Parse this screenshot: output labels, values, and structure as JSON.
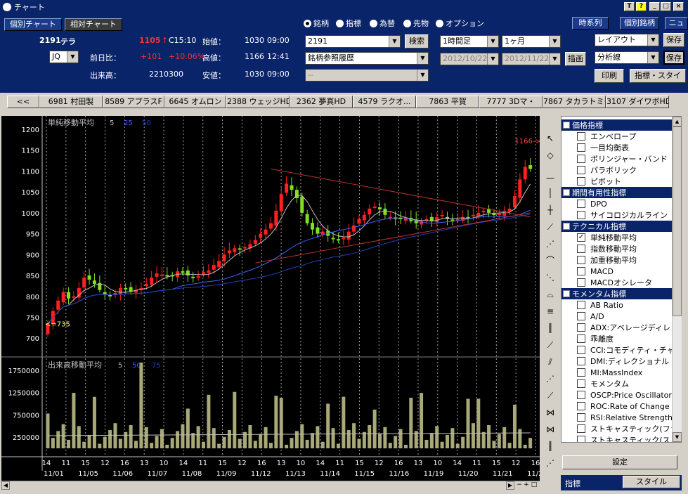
{
  "window": {
    "title": "チャート",
    "buttons": [
      "T",
      "?",
      "_",
      "□",
      "×"
    ]
  },
  "top": {
    "tab_individual": "個別チャート",
    "tab_relative": "相対チャート",
    "code": "2191",
    "name": "テラ",
    "price": "1105",
    "arrow": "↑",
    "time": "C15:10",
    "open_label": "始値：",
    "open_value": "1030",
    "open_time": "09:00",
    "high_label": "高値：",
    "high_value": "1166",
    "high_time": "12:41",
    "low_label": "安値：",
    "low_value": "1030",
    "low_time": "09:00",
    "market": "JQ",
    "change_label": "前日比：",
    "change_value": "+101",
    "change_pct": "+10.06%",
    "volume_label": "出来高：",
    "volume_value": "2210300",
    "radios": [
      "銘柄",
      "指標",
      "為替",
      "先物",
      "オプション"
    ],
    "radio_selected": 0,
    "symbol_input": "2191",
    "search_btn": "検索",
    "history_combo": "銘柄参照履歴",
    "third_combo": "--",
    "interval": "1時間足",
    "period": "1ヶ月",
    "date_from": "2012/10/22",
    "date_to": "2012/11/22",
    "draw_btn": "描画",
    "timeseries_btn": "時系列",
    "individual_btn": "個別銘柄",
    "news_btn": "ニュ",
    "layout_combo": "レイアウト",
    "save1": "保存",
    "analysis_combo": "分析線",
    "save2": "保存",
    "print_btn": "印刷",
    "indicator_style_btn": "指標・スタイ"
  },
  "stocks": [
    "<<",
    "6981 村田製",
    "8589 アプラスF",
    "6645 オムロン",
    "2388 ウェッジHD",
    "2362 夢真HD",
    "4579 ラクオ...",
    "7863 平賀",
    "7777 3Dマ・",
    "7867 タカラトミー",
    "3107 ダイワボHD"
  ],
  "chart_data": {
    "type": "candlestick",
    "price_title": "単純移動平均",
    "price_ma": [
      "5",
      "25",
      "50"
    ],
    "volume_title": "出来高移動平均",
    "volume_ma": [
      "5",
      "50",
      "75"
    ],
    "yticks": [
      1200,
      1150,
      1100,
      1050,
      1000,
      950,
      900,
      850,
      800,
      750,
      700
    ],
    "ylim": [
      660,
      1215
    ],
    "vol_ticks": [
      1750000,
      1250000,
      750000,
      250000
    ],
    "vol_tick_labels": [
      "1750000",
      "1250000",
      "750000",
      "250000"
    ],
    "vol_max": 2000000,
    "low_mark": "<=735",
    "high_mark": "1166->",
    "xticks": [
      "14",
      "11",
      "15",
      "12",
      "16",
      "13",
      "10",
      "14",
      "11",
      "15",
      "12",
      "16",
      "13",
      "10",
      "14",
      "11",
      "15",
      "12",
      "16",
      "13",
      "10",
      "14",
      "11",
      "15",
      "12",
      "16"
    ],
    "dates": [
      "11/01",
      "11/05",
      "11/06",
      "11/07",
      "11/08",
      "11/09",
      "11/12",
      "11/13",
      "11/14",
      "11/15",
      "11/16",
      "11/19",
      "11/20",
      "11/21",
      "11/22"
    ],
    "close": [
      735,
      765,
      790,
      810,
      795,
      800,
      820,
      845,
      840,
      830,
      815,
      805,
      800,
      808,
      820,
      818,
      812,
      815,
      820,
      830,
      845,
      855,
      852,
      848,
      850,
      860,
      858,
      850,
      845,
      848,
      858,
      862,
      875,
      885,
      900,
      910,
      915,
      912,
      918,
      925,
      935,
      950,
      960,
      975,
      1005,
      1045,
      1070,
      1055,
      1035,
      1000,
      975,
      960,
      950,
      955,
      945,
      938,
      935,
      940,
      955,
      970,
      985,
      995,
      1010,
      1015,
      1008,
      995,
      990,
      985,
      985,
      988,
      980,
      975,
      980,
      985,
      980,
      990,
      995,
      985,
      982,
      985,
      990,
      988,
      995,
      1000,
      1005,
      1000,
      995,
      998,
      1005,
      1010,
      1040,
      1080,
      1110,
      1105
    ],
    "colors": {
      "up": "#ff2020",
      "down": "#80e020",
      "ma5": "#c0c0c0",
      "ma25": "#4060ff",
      "ma50": "#2040c0",
      "trend": "#c03030",
      "volume": "#a8a878",
      "accent": "#0a246a"
    }
  },
  "indicators": {
    "categories": [
      {
        "name": "価格指標",
        "items": [
          "エンベロープ",
          "一目均衡表",
          "ボリンジャー・バンド",
          "パラボリック",
          "ピボット"
        ]
      },
      {
        "name": "期間有用性指標",
        "items": [
          "DPO",
          "サイコロジカルライン"
        ]
      },
      {
        "name": "テクニカル指標",
        "items": [
          "単純移動平均",
          "指数移動平均",
          "加重移動平均",
          "MACD",
          "MACDオシレータ"
        ]
      },
      {
        "name": "モメンタム指標",
        "items": [
          "AB Ratio",
          "A/D",
          "ADX:アベレージディレ",
          "乖離度",
          "CCI:コモディティ・チャ",
          "DMI:ディレクショナル・",
          "MI:MassIndex",
          "モメンタム",
          "OSCP:Price Oscillator",
          "ROC:Rate of Change",
          "RSI:Relative Strength",
          "ストキャスティック(ファ",
          "ストキャスティック(ス"
        ]
      }
    ],
    "checked": "単純移動平均",
    "settings_btn": "設定",
    "tab_indicator": "指標",
    "tab_style": "スタイル"
  }
}
